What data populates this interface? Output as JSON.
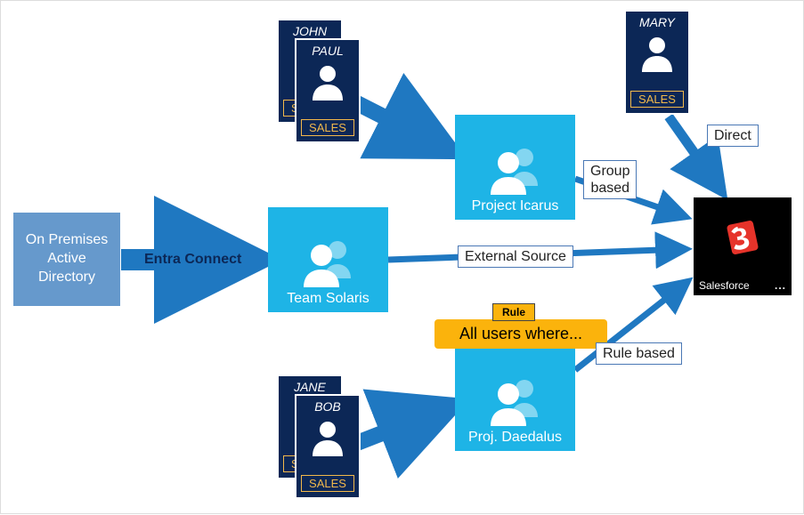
{
  "nodes": {
    "onprem": "On Premises\nActive\nDirectory",
    "team_solaris": "Team Solaris",
    "project_icarus": "Project Icarus",
    "proj_daedalus": "Proj. Daedalus",
    "salesforce": "Salesforce"
  },
  "users": {
    "john": {
      "name": "JOHN",
      "dept": "SALES"
    },
    "paul": {
      "name": "PAUL",
      "dept": "SALES"
    },
    "jane": {
      "name": "JANE",
      "dept": "SALES"
    },
    "bob": {
      "name": "BOB",
      "dept": "SALES"
    },
    "mary": {
      "name": "MARY",
      "dept": "SALES"
    }
  },
  "labels": {
    "entra_connect": "Entra Connect",
    "external_source": "External Source",
    "direct": "Direct",
    "group_based": "Group\nbased",
    "rule_based": "Rule based",
    "rule_tag": "Rule",
    "rule_text": "All users where..."
  },
  "icons": {
    "ellipsis": "..."
  },
  "colors": {
    "azure_blue": "#1eb4e6",
    "dark_navy": "#0c2756",
    "accent_yellow": "#fbb30c",
    "arrow": "#1f78c1",
    "onprem": "#6699cc"
  }
}
